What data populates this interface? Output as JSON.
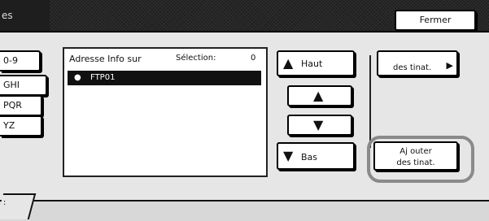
{
  "titlebar": {
    "title": "es",
    "close_label": "Fermer"
  },
  "left_tabs": {
    "top_partial": "0-9",
    "items": [
      "GHI",
      "PQR",
      "YZ"
    ]
  },
  "list": {
    "header": "Adresse Info sur",
    "selection_label": "Sélection:",
    "selection_count": "0",
    "rows": [
      {
        "icon": "person-icon",
        "label": "FTP01"
      }
    ]
  },
  "nav": {
    "top_label": "Haut",
    "bottom_label": "Bas"
  },
  "actions": {
    "destination_label": "des tinat.",
    "add_line1": "Aj outer",
    "add_line2": "des tinat."
  },
  "bottom_tab": {
    "label": ":"
  }
}
